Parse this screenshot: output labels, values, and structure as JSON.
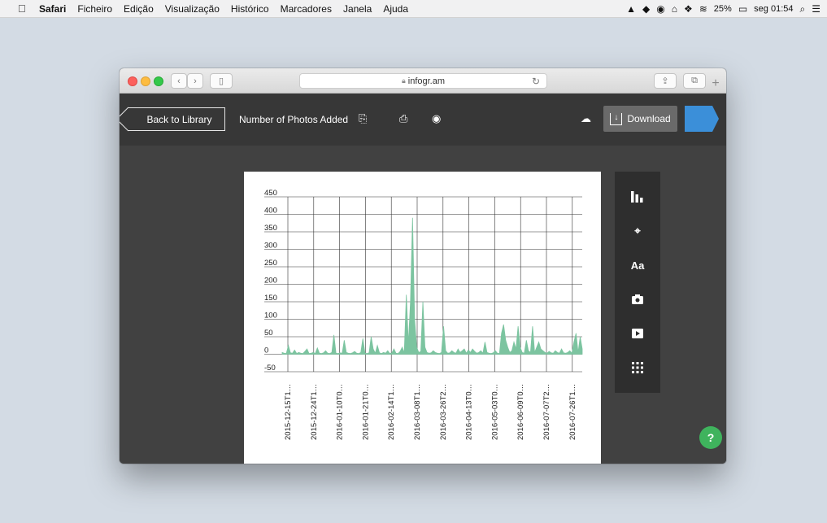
{
  "menubar": {
    "app": "Safari",
    "items": [
      "Ficheiro",
      "Edição",
      "Visualização",
      "Histórico",
      "Marcadores",
      "Janela",
      "Ajuda"
    ],
    "battery": "25%",
    "clock": "seg 01:54"
  },
  "browser": {
    "url": "infogr.am"
  },
  "app_header": {
    "back_label": "Back to Library",
    "title": "Number of Photos Added",
    "download_label": "Download"
  },
  "help_label": "?",
  "sidebar": {
    "text_tool_label": "Aa"
  },
  "colors": {
    "accent_blue": "#3b8fd9",
    "chart_fill": "#7cc4a0",
    "help_green": "#3fb35d"
  },
  "chart_data": {
    "type": "area",
    "title": "",
    "xlabel": "",
    "ylabel": "",
    "ylim": [
      -50,
      450
    ],
    "yticks": [
      450,
      400,
      350,
      300,
      250,
      200,
      150,
      100,
      50,
      0,
      -50
    ],
    "x_tick_labels": [
      "2015-12-15T1…",
      "2015-12-24T1…",
      "2016-01-10T0…",
      "2016-01-21T0…",
      "2016-02-14T1…",
      "2016-03-08T1…",
      "2016-03-26T2…",
      "2016-04-13T0…",
      "2016-05-03T0…",
      "2016-06-09T0…",
      "2016-07-07T2…",
      "2016-07-26T1…"
    ],
    "grid": true,
    "values": [
      5,
      3,
      2,
      25,
      4,
      3,
      12,
      2,
      5,
      3,
      2,
      8,
      15,
      2,
      3,
      5,
      2,
      18,
      3,
      2,
      4,
      10,
      3,
      2,
      5,
      55,
      3,
      2,
      4,
      3,
      40,
      5,
      3,
      2,
      4,
      8,
      3,
      2,
      5,
      45,
      3,
      2,
      4,
      50,
      15,
      3,
      25,
      4,
      2,
      5,
      3,
      10,
      2,
      4,
      15,
      3,
      2,
      8,
      20,
      4,
      170,
      30,
      150,
      390,
      100,
      20,
      5,
      8,
      150,
      20,
      5,
      3,
      4,
      10,
      5,
      3,
      2,
      5,
      80,
      10,
      3,
      4,
      10,
      5,
      3,
      15,
      5,
      10,
      15,
      3,
      12,
      5,
      15,
      8,
      3,
      5,
      10,
      3,
      35,
      5,
      3,
      2,
      4,
      10,
      3,
      2,
      60,
      85,
      40,
      20,
      5,
      10,
      35,
      15,
      80,
      20,
      5,
      3,
      40,
      10,
      5,
      80,
      5,
      20,
      35,
      15,
      10,
      5,
      3,
      8,
      4,
      3,
      10,
      5,
      3,
      15,
      4,
      3,
      5,
      10,
      3,
      35,
      60,
      5,
      50,
      15
    ]
  }
}
